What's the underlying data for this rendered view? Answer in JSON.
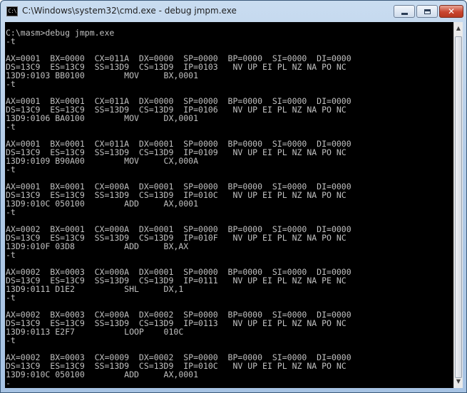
{
  "window": {
    "title": "C:\\Windows\\system32\\cmd.exe - debug  jmpm.exe",
    "icon_text": "C:\\",
    "close_glyph": "✕"
  },
  "console": {
    "lines": [
      "C:\\masm>debug jmpm.exe",
      "-t",
      "",
      "AX=0001  BX=0000  CX=011A  DX=0000  SP=0000  BP=0000  SI=0000  DI=0000",
      "DS=13C9  ES=13C9  SS=13D9  CS=13D9  IP=0103   NV UP EI PL NZ NA PO NC",
      "13D9:0103 BB0100        MOV     BX,0001",
      "-t",
      "",
      "AX=0001  BX=0001  CX=011A  DX=0000  SP=0000  BP=0000  SI=0000  DI=0000",
      "DS=13C9  ES=13C9  SS=13D9  CS=13D9  IP=0106   NV UP EI PL NZ NA PO NC",
      "13D9:0106 BA0100        MOV     DX,0001",
      "-t",
      "",
      "AX=0001  BX=0001  CX=011A  DX=0001  SP=0000  BP=0000  SI=0000  DI=0000",
      "DS=13C9  ES=13C9  SS=13D9  CS=13D9  IP=0109   NV UP EI PL NZ NA PO NC",
      "13D9:0109 B90A00        MOV     CX,000A",
      "-t",
      "",
      "AX=0001  BX=0001  CX=000A  DX=0001  SP=0000  BP=0000  SI=0000  DI=0000",
      "DS=13C9  ES=13C9  SS=13D9  CS=13D9  IP=010C   NV UP EI PL NZ NA PO NC",
      "13D9:010C 050100        ADD     AX,0001",
      "-t",
      "",
      "AX=0002  BX=0001  CX=000A  DX=0001  SP=0000  BP=0000  SI=0000  DI=0000",
      "DS=13C9  ES=13C9  SS=13D9  CS=13D9  IP=010F   NV UP EI PL NZ NA PO NC",
      "13D9:010F 03D8          ADD     BX,AX",
      "-t",
      "",
      "AX=0002  BX=0003  CX=000A  DX=0001  SP=0000  BP=0000  SI=0000  DI=0000",
      "DS=13C9  ES=13C9  SS=13D9  CS=13D9  IP=0111   NV UP EI PL NZ NA PE NC",
      "13D9:0111 D1E2          SHL     DX,1",
      "-t",
      "",
      "AX=0002  BX=0003  CX=000A  DX=0002  SP=0000  BP=0000  SI=0000  DI=0000",
      "DS=13C9  ES=13C9  SS=13D9  CS=13D9  IP=0113   NV UP EI PL NZ NA PO NC",
      "13D9:0113 E2F7          LOOP    010C",
      "-t",
      "",
      "AX=0002  BX=0003  CX=0009  DX=0002  SP=0000  BP=0000  SI=0000  DI=0000",
      "DS=13C9  ES=13C9  SS=13D9  CS=13D9  IP=010C   NV UP EI PL NZ NA PO NC",
      "13D9:010C 050100        ADD     AX,0001",
      "-"
    ]
  },
  "colors": {
    "console_background": "#000000",
    "console_text": "#c0c0c0"
  }
}
